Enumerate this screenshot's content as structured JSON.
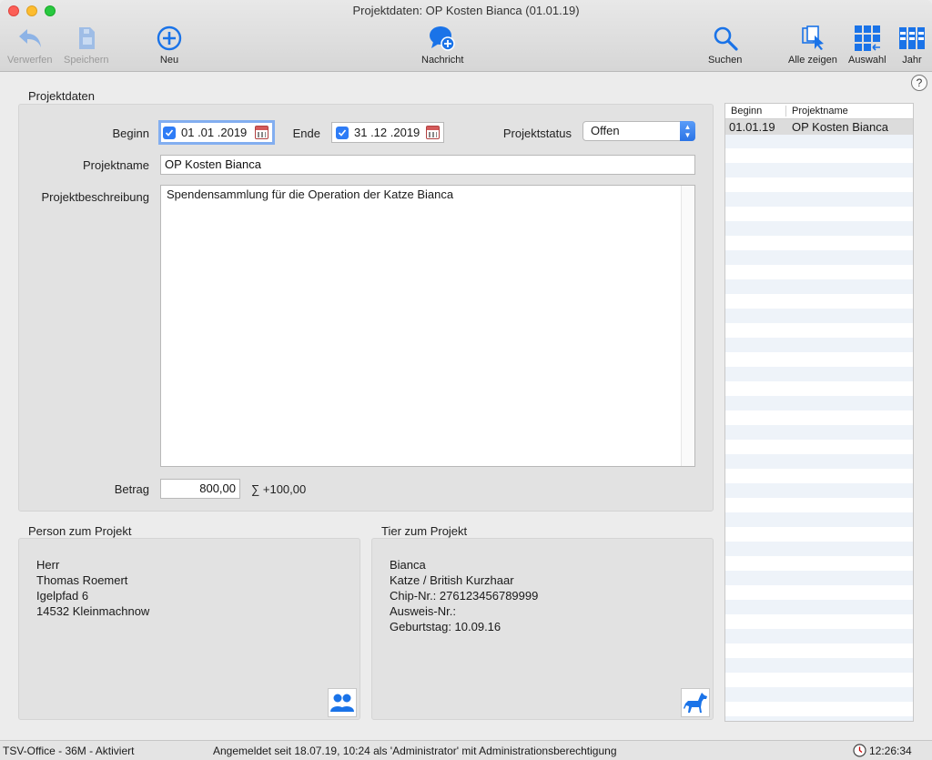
{
  "window": {
    "title": "Projektdaten: OP Kosten Bianca (01.01.19)"
  },
  "toolbar": {
    "discard": "Verwerfen",
    "save": "Speichern",
    "new": "Neu",
    "message": "Nachricht",
    "search": "Suchen",
    "show_all": "Alle zeigen",
    "selection": "Auswahl",
    "year": "Jahr"
  },
  "help": "?",
  "project": {
    "section_title": "Projektdaten",
    "begin_label": "Beginn",
    "begin_value": "01 .01 .2019",
    "end_label": "Ende",
    "end_value": "31 .12 .2019",
    "status_label": "Projektstatus",
    "status_value": "Offen",
    "name_label": "Projektname",
    "name_value": "OP Kosten Bianca",
    "desc_label": "Projektbeschreibung",
    "desc_value": "Spendensammlung für die Operation der Katze Bianca",
    "amount_label": "Betrag",
    "amount_value": "800,00",
    "sum_text": "∑ +100,00"
  },
  "person": {
    "section_title": "Person zum Projekt",
    "lines": [
      "Herr",
      "Thomas Roemert",
      "Igelpfad 6",
      "14532 Kleinmachnow"
    ]
  },
  "animal": {
    "section_title": "Tier zum Projekt",
    "lines": [
      "Bianca",
      "Katze / British Kurzhaar",
      "Chip-Nr.: 276123456789999",
      "Ausweis-Nr.:",
      "Geburtstag: 10.09.16"
    ]
  },
  "list": {
    "col_begin": "Beginn",
    "col_name": "Projektname",
    "rows": [
      {
        "begin": "01.01.19",
        "name": "OP Kosten Bianca"
      }
    ]
  },
  "status": {
    "app": "TSV-Office - 36M - Aktiviert",
    "login": "Angemeldet seit 18.07.19, 10:24 als 'Administrator' mit Administrationsberechtigung",
    "time": "12:26:34"
  },
  "colors": {
    "accent": "#2e7cf6",
    "icon_blue": "#1a73e8"
  }
}
